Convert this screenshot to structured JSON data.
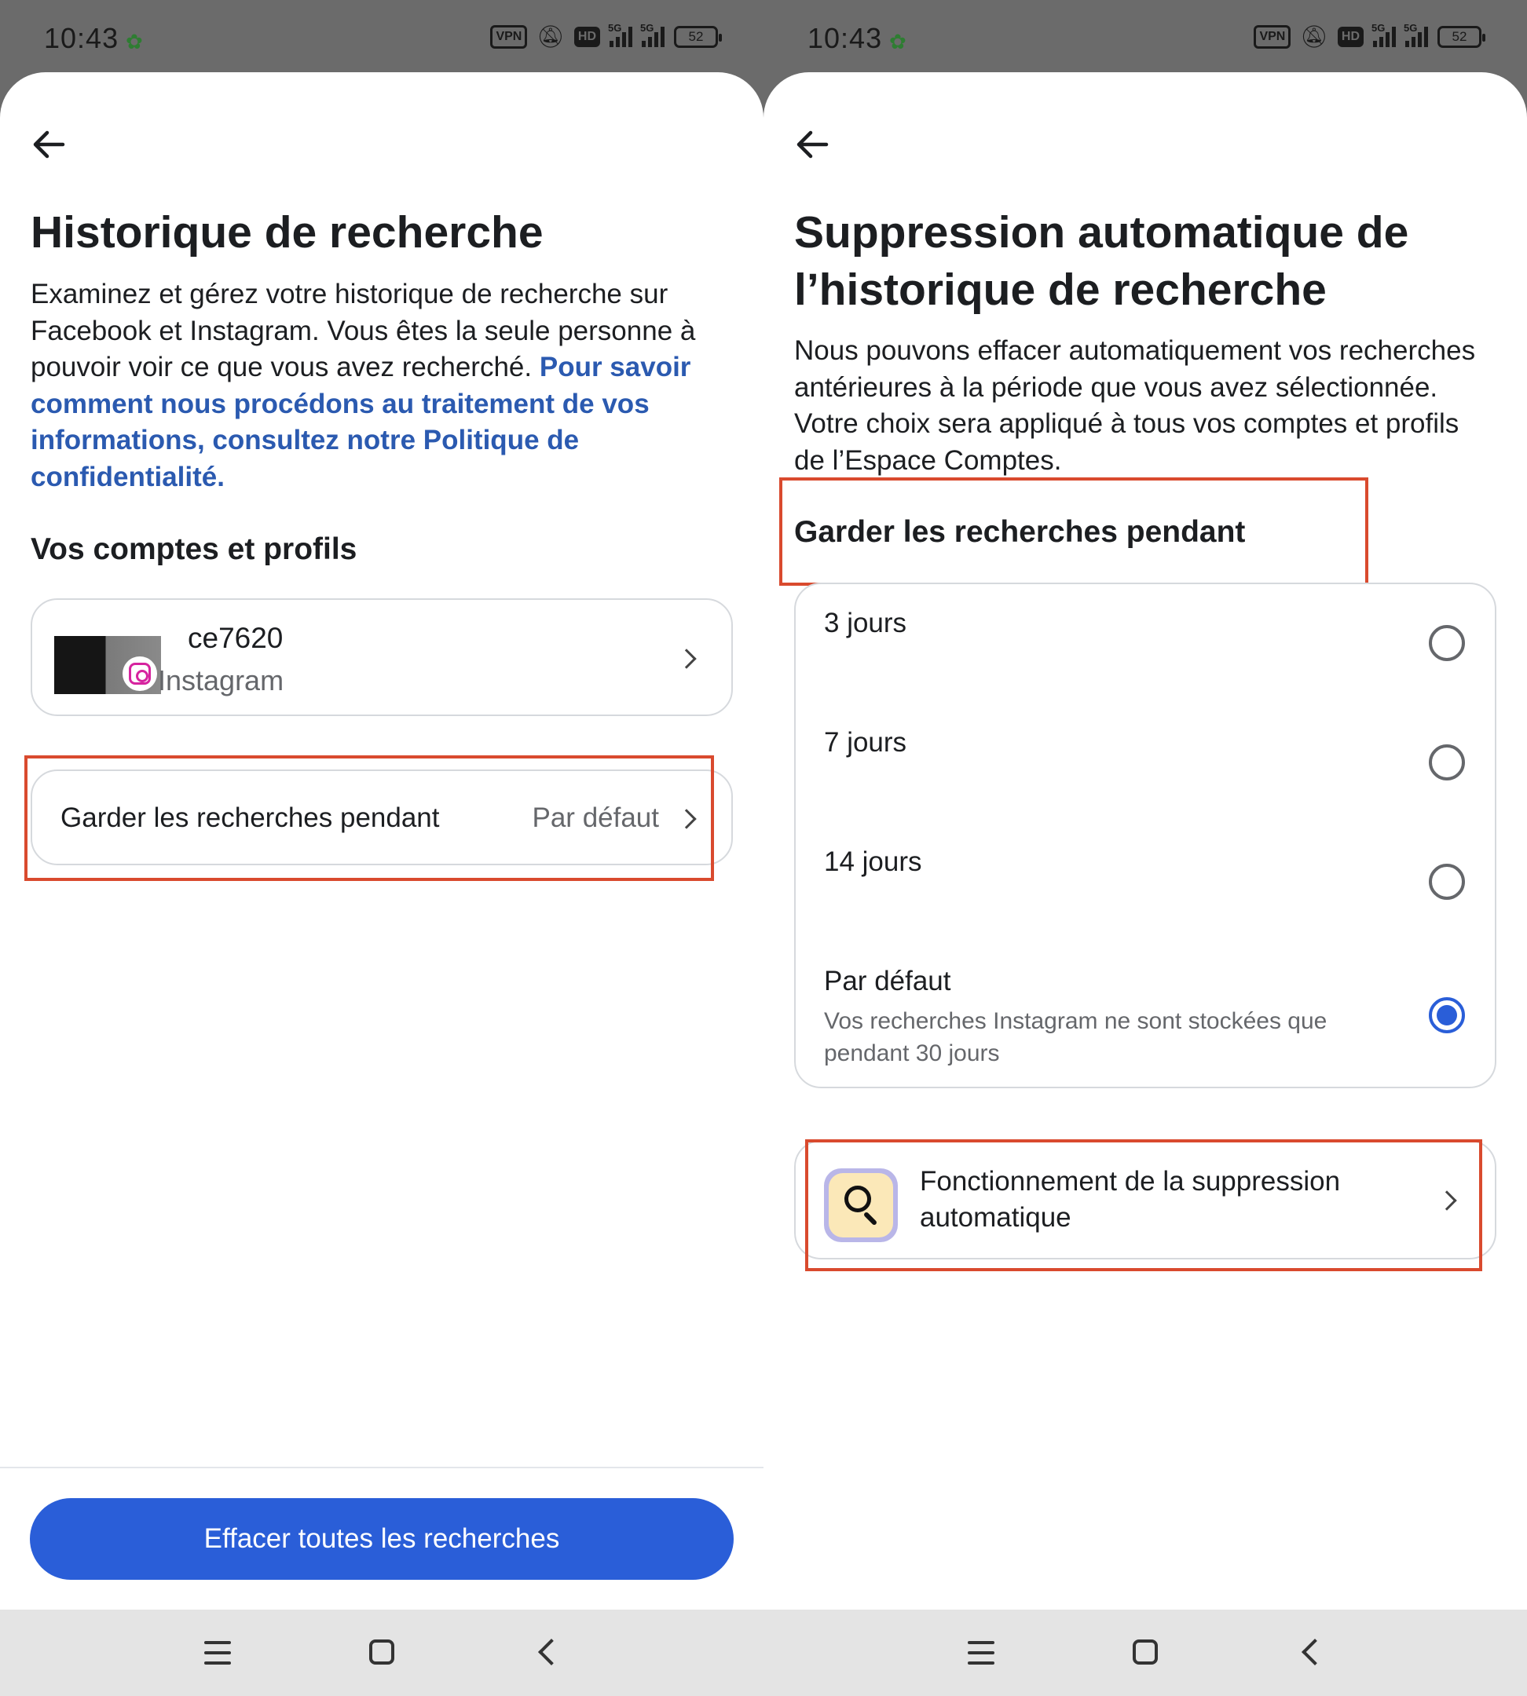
{
  "status_bar": {
    "time": "10:43",
    "vpn": "VPN",
    "hd": "HD",
    "net1": "5G",
    "net2": "5G",
    "battery": "52"
  },
  "left": {
    "title": "Historique de recherche",
    "description": "Examinez et gérez votre historique de recherche sur Facebook et Instagram. Vous êtes la seule personne à pouvoir voir ce que vous avez recherché.",
    "link": "Pour savoir comment nous procédons au traitement de vos informations, consultez notre Politique de confidentialité.",
    "section_title": "Vos comptes et profils",
    "account": {
      "name": "ce7620",
      "platform": "Instagram"
    },
    "setting": {
      "label": "Garder les recherches pendant",
      "value": "Par défaut"
    },
    "clear_button": "Effacer toutes les recherches"
  },
  "right": {
    "title_line1": "Suppression automatique de",
    "title_line2": "l’historique de recherche",
    "description": "Nous pouvons effacer automatiquement vos recherches antérieures à la période que vous avez sélectionnée. Votre choix sera appliqué à tous vos comptes et profils de l’Espace Comptes.",
    "section_title": "Garder les recherches pendant",
    "options": [
      {
        "label": "3 jours",
        "selected": false
      },
      {
        "label": "7 jours",
        "selected": false
      },
      {
        "label": "14 jours",
        "selected": false
      },
      {
        "label": "Par défaut",
        "description": "Vos recherches Instagram ne sont stockées que pendant 30 jours",
        "selected": true
      }
    ],
    "info_row": "Fonctionnement de la suppression automatique"
  },
  "colors": {
    "accent": "#2a5ed8",
    "link": "#2b5ab0",
    "highlight": "#d94a2e",
    "secondary_text": "#65676b"
  }
}
